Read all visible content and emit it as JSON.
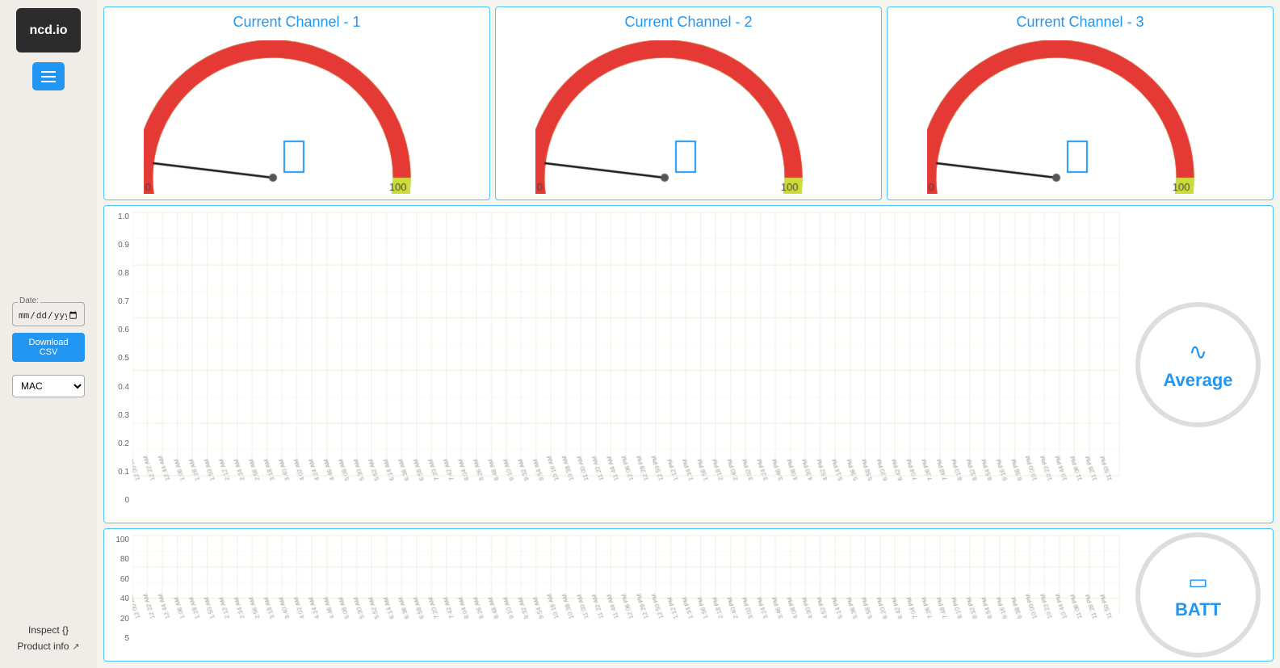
{
  "sidebar": {
    "logo": "ncd.io",
    "menu_icon": "menu-icon",
    "date_label": "Date:",
    "date_placeholder": "mm/dd/yyyy",
    "download_btn": "Download CSV",
    "mac_label": "MAC",
    "mac_options": [
      "MAC"
    ],
    "inspect_label": "Inspect {}",
    "product_label": "Product info",
    "product_icon": "external-link-icon"
  },
  "gauges": [
    {
      "title": "Current Channel - 1",
      "min": 0,
      "max": 100,
      "value": 0
    },
    {
      "title": "Current Channel - 2",
      "min": 0,
      "max": 100,
      "value": 0
    },
    {
      "title": "Current Channel - 3",
      "min": 0,
      "max": 100,
      "value": 0
    }
  ],
  "middle_chart": {
    "y_labels": [
      "1.0",
      "0.9",
      "0.8",
      "0.7",
      "0.6",
      "0.5",
      "0.4",
      "0.3",
      "0.2",
      "0.1",
      "0"
    ],
    "widget_icon": "wave-icon",
    "widget_label": "Average"
  },
  "bottom_chart": {
    "y_labels": [
      "100",
      "80",
      "60",
      "40",
      "20",
      "5"
    ],
    "widget_icon": "battery-icon",
    "widget_label": "BATT"
  },
  "time_labels": [
    "12:00 AM",
    "12:22 AM",
    "12:44 AM",
    "1:06 AM",
    "1:28 AM",
    "1:50 AM",
    "2:12 AM",
    "2:34 AM",
    "2:56 AM",
    "3:18 AM",
    "3:40 AM",
    "4:02 AM",
    "4:24 AM",
    "4:46 AM",
    "5:08 AM",
    "5:30 AM",
    "5:52 AM",
    "6:14 AM",
    "6:36 AM",
    "6:58 AM",
    "7:20 AM",
    "7:42 AM",
    "8:04 AM",
    "8:26 AM",
    "8:48 AM",
    "9:10 AM",
    "9:32 AM",
    "9:54 AM",
    "10:16 AM",
    "10:38 AM",
    "11:00 AM",
    "11:22 AM",
    "11:44 AM",
    "12:06 PM",
    "12:28 PM",
    "12:50 PM",
    "1:12 PM",
    "1:34 PM",
    "1:56 PM",
    "2:18 PM",
    "2:40 PM",
    "3:02 PM",
    "3:24 PM",
    "3:46 PM",
    "4:08 PM",
    "4:30 PM",
    "4:52 PM",
    "5:14 PM",
    "5:36 PM",
    "5:58 PM",
    "6:20 PM",
    "6:42 PM",
    "7:04 PM",
    "7:26 PM",
    "7:48 PM",
    "8:10 PM",
    "8:32 PM",
    "8:54 PM",
    "9:16 PM",
    "9:38 PM",
    "10:00 PM",
    "10:22 PM",
    "10:44 PM",
    "11:06 PM",
    "11:28 PM",
    "11:50 PM"
  ],
  "colors": {
    "accent": "#2196F3",
    "border": "#4fc3f7",
    "gauge_green": "#4caf50",
    "gauge_yellow": "#ffeb3b",
    "gauge_red": "#e53935",
    "gauge_track": "#e0e0e0"
  }
}
